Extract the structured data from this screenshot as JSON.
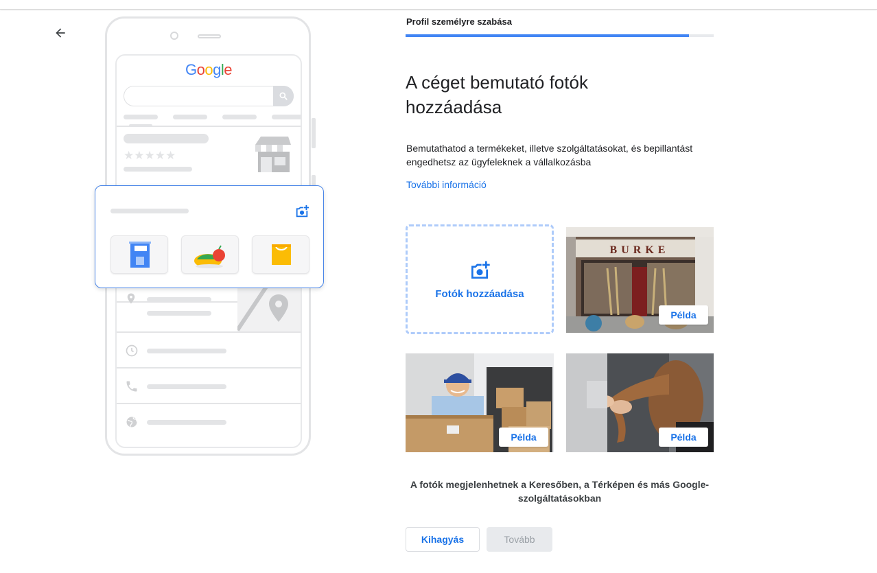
{
  "header": {
    "step_label": "Profil személyre szabása",
    "progress_fraction": 0.92
  },
  "illustration": {
    "brand_letters": [
      {
        "ch": "G",
        "color": "#4285F4"
      },
      {
        "ch": "o",
        "color": "#EA4335"
      },
      {
        "ch": "o",
        "color": "#FBBC05"
      },
      {
        "ch": "g",
        "color": "#4285F4"
      },
      {
        "ch": "l",
        "color": "#34A853"
      },
      {
        "ch": "e",
        "color": "#EA4335"
      }
    ],
    "stars": "★★★★★"
  },
  "main": {
    "title": "A céget bemutató fotók hozzáadása",
    "description": "Bemutathatod a termékeket, illetve szolgáltatásokat, és bepillantást engedhetsz az ügyfeleknek a vállalkozásba",
    "more_info_link": "További információ",
    "add_photos_label": "Fotók hozzáadása",
    "shopfront_sign": "BURKE",
    "example_label": "Példa",
    "footnote": "A fotók megjelenhetnek a Keresőben, a Térképen és más Google-szolgáltatásokban"
  },
  "actions": {
    "skip_label": "Kihagyás",
    "next_label": "Tovább"
  },
  "colors": {
    "accent": "#1a73e8",
    "progress": "#4285f4",
    "dashed_border": "#aecbfa"
  }
}
